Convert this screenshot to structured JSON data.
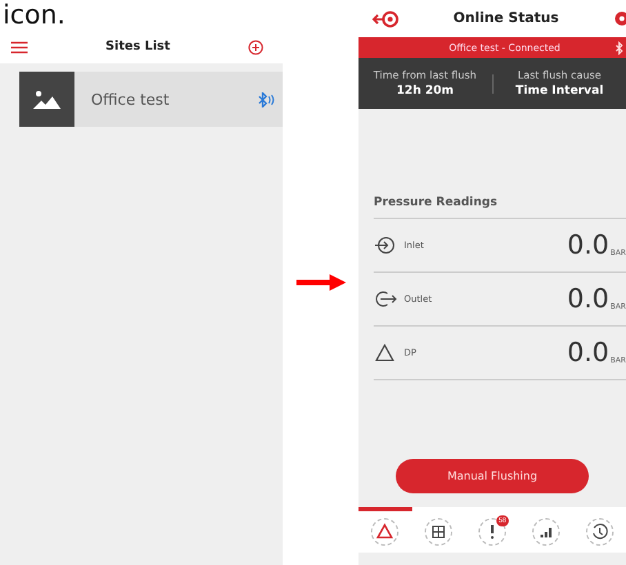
{
  "caption": "icon.",
  "sites_screen": {
    "title": "Sites List",
    "sites": [
      {
        "name": "Office test"
      }
    ]
  },
  "status_screen": {
    "title": "Online Status",
    "connection": "Office test - Connected",
    "stats": [
      {
        "label": "Time from last flush",
        "value": "12h 20m"
      },
      {
        "label": "Last flush cause",
        "value": "Time Interval"
      }
    ],
    "section_title": "Pressure Readings",
    "readings": [
      {
        "kind": "inlet",
        "label": "Inlet",
        "value": "0.0",
        "unit": "BAR"
      },
      {
        "kind": "outlet",
        "label": "Outlet",
        "value": "0.0",
        "unit": "BAR"
      },
      {
        "kind": "dp",
        "label": "DP",
        "value": "0.0",
        "unit": "BAR"
      }
    ],
    "action_button": "Manual Flushing",
    "tabs": [
      {
        "kind": "triangle",
        "selected": true
      },
      {
        "kind": "grid",
        "selected": false
      },
      {
        "kind": "alarm",
        "selected": false,
        "badge": "58"
      },
      {
        "kind": "signal",
        "selected": false
      },
      {
        "kind": "history",
        "selected": false
      }
    ]
  }
}
